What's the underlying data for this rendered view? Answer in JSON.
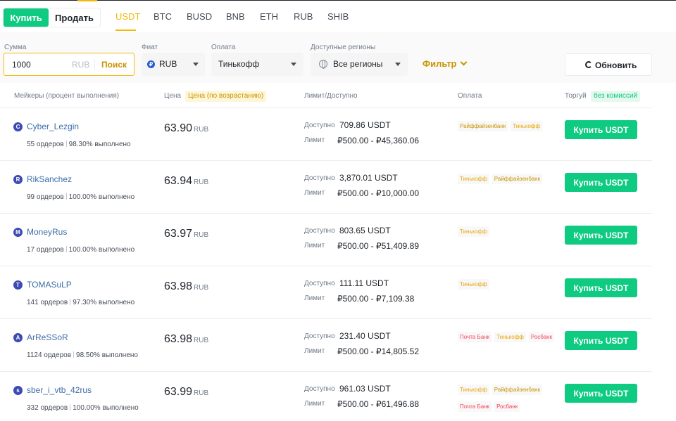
{
  "header": {
    "buy_label": "Купить",
    "sell_label": "Продать",
    "coins": [
      "USDT",
      "BTC",
      "BUSD",
      "BNB",
      "ETH",
      "RUB",
      "SHIB"
    ],
    "active_coin": "USDT"
  },
  "filters": {
    "amount": {
      "label": "Сумма",
      "value": "1000",
      "currency": "RUB",
      "search_label": "Поиск"
    },
    "fiat": {
      "label": "Фиат",
      "value": "RUB",
      "icon": "ruble-icon"
    },
    "payment": {
      "label": "Оплата",
      "value": "Тинькофф"
    },
    "regions": {
      "label": "Доступные регионы",
      "value": "Все регионы",
      "icon": "globe-icon"
    },
    "filter_label": "Фильтр",
    "refresh_label": "Обновить"
  },
  "columns": {
    "makers": "Мейкеры (процент выполнения)",
    "price": "Цена",
    "price_sort": "Цена (по возрастанию)",
    "limit": "Лимит/Доступно",
    "payment": "Оплата",
    "trade": "Торгуй",
    "no_fee": "без комиссий"
  },
  "row_labels": {
    "available": "Доступно",
    "limit": "Лимит",
    "buy_button": "Купить USDT"
  },
  "colors": {
    "accent": "#f0b90b",
    "buy": "#0ecb81",
    "tinkoff": "#e9a70b",
    "raiffeisen": "#c99400",
    "red_bank": "#f6465d"
  },
  "offers": [
    {
      "initial": "C",
      "name": "Cyber_Lezgin",
      "orders": "55 ордеров",
      "completion": "98.30% выполнено",
      "price": "63.90",
      "currency": "RUB",
      "available": "709.86 USDT",
      "limit": "₽500.00 - ₽45,360.06",
      "payments": [
        {
          "name": "Райффайзенбанк",
          "color": "#c99400"
        },
        {
          "name": "Тинькофф",
          "color": "#e9a70b"
        }
      ]
    },
    {
      "initial": "R",
      "name": "RikSanchez",
      "orders": "99 ордеров",
      "completion": "100.00% выполнено",
      "price": "63.94",
      "currency": "RUB",
      "available": "3,870.01 USDT",
      "limit": "₽500.00 - ₽10,000.00",
      "payments": [
        {
          "name": "Тинькофф",
          "color": "#e9a70b"
        },
        {
          "name": "Райффайзенбанк",
          "color": "#c99400"
        }
      ]
    },
    {
      "initial": "M",
      "name": "MoneyRus",
      "orders": "17 ордеров",
      "completion": "100.00% выполнено",
      "price": "63.97",
      "currency": "RUB",
      "available": "803.65 USDT",
      "limit": "₽500.00 - ₽51,409.89",
      "payments": [
        {
          "name": "Тинькофф",
          "color": "#e9a70b"
        }
      ]
    },
    {
      "initial": "T",
      "name": "TOMASuLP",
      "orders": "141 ордеров",
      "completion": "97.30% выполнено",
      "price": "63.98",
      "currency": "RUB",
      "available": "111.11 USDT",
      "limit": "₽500.00 - ₽7,109.38",
      "payments": [
        {
          "name": "Тинькофф",
          "color": "#e9a70b"
        }
      ]
    },
    {
      "initial": "A",
      "name": "ArReSSoR",
      "orders": "1124 ордеров",
      "completion": "98.50% выполнено",
      "price": "63.98",
      "currency": "RUB",
      "available": "231.40 USDT",
      "limit": "₽500.00 - ₽14,805.52",
      "payments": [
        {
          "name": "Почта Банк",
          "color": "#f6465d"
        },
        {
          "name": "Тинькофф",
          "color": "#e9a70b"
        },
        {
          "name": "Росбанк",
          "color": "#f6465d"
        }
      ]
    },
    {
      "initial": "s",
      "name": "sber_i_vtb_42rus",
      "orders": "332 ордеров",
      "completion": "100.00% выполнено",
      "price": "63.99",
      "currency": "RUB",
      "available": "961.03 USDT",
      "limit": "₽500.00 - ₽61,496.88",
      "payments": [
        {
          "name": "Тинькофф",
          "color": "#e9a70b"
        },
        {
          "name": "Райффайзенбанк",
          "color": "#c99400"
        },
        {
          "name": "Почта Банк",
          "color": "#f6465d"
        },
        {
          "name": "Росбанк",
          "color": "#f6465d"
        }
      ]
    }
  ]
}
